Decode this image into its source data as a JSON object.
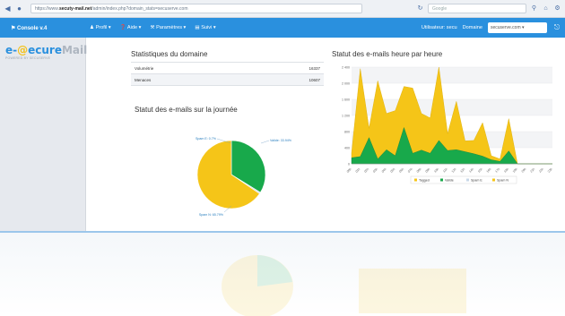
{
  "browser": {
    "url_prefix": "https://www.",
    "url_domain": "secuty-mail.net",
    "url_path": "/admin/index.php?domain_stats=secuserve.com",
    "search_placeholder": "Google"
  },
  "topbar": {
    "brand": "Console v.4",
    "menu": [
      "Profil",
      "Aide",
      "Paramètres",
      "Suivi"
    ],
    "user_label": "Utilisateur: secu",
    "domain_label": "Domaine",
    "domain_value": "secuserve.com"
  },
  "sidebar": {
    "logo_prefix": "e-",
    "logo_main": "ecure",
    "logo_suffix": "Mail",
    "logo_sub": "POWERED BY SECUSERVE"
  },
  "stats": {
    "title": "Statistiques du domaine",
    "rows": [
      {
        "label": "Volumétrie",
        "value": "16337"
      },
      {
        "label": "Menaces",
        "value": "10607"
      }
    ]
  },
  "day_chart": {
    "title": "Statut des e-mails sur la journée",
    "label_top_left": "Spam E: 0.7%",
    "label_top_right": "Valide: 33.94%",
    "label_bottom_left": "Spam N: 65.79%"
  },
  "hour_chart": {
    "title": "Statut des e-mails heure par heure",
    "legend": [
      "Tagged",
      "Valide",
      "Spam E",
      "Spam N"
    ]
  },
  "colors": {
    "topbar": "#2a90de",
    "valide": "#18a94b",
    "spam": "#f5c518",
    "spam_e": "#c8d8e8"
  },
  "chart_data": [
    {
      "type": "pie",
      "title": "Statut des e-mails sur la journée",
      "slices": [
        {
          "label": "Valide",
          "value": 33.94
        },
        {
          "label": "Spam E",
          "value": 0.7
        },
        {
          "label": "Spam N",
          "value": 65.79
        }
      ]
    },
    {
      "type": "area",
      "title": "Statut des e-mails heure par heure",
      "x": [
        "00h",
        "01h",
        "02h",
        "03h",
        "04h",
        "05h",
        "06h",
        "07h",
        "08h",
        "09h",
        "10h",
        "11h",
        "12h",
        "13h",
        "14h",
        "15h",
        "16h",
        "17h",
        "18h",
        "19h",
        "20h",
        "21h",
        "22h",
        "23h"
      ],
      "ylim": [
        0,
        2400
      ],
      "yticks": [
        "0",
        "400",
        "800",
        "1 200",
        "1 600",
        "2 000",
        "2 400"
      ],
      "series": [
        {
          "name": "Valide",
          "values": [
            150,
            180,
            650,
            120,
            350,
            200,
            900,
            260,
            340,
            260,
            580,
            330,
            350,
            300,
            250,
            190,
            100,
            60,
            320,
            0,
            0,
            0,
            0,
            0
          ]
        },
        {
          "name": "Spam N",
          "values": [
            120,
            2180,
            230,
            1940,
            900,
            1120,
            1020,
            1620,
            910,
            880,
            1820,
            420,
            1200,
            270,
            330,
            830,
            100,
            60,
            800,
            0,
            0,
            0,
            0,
            0
          ]
        }
      ]
    }
  ]
}
